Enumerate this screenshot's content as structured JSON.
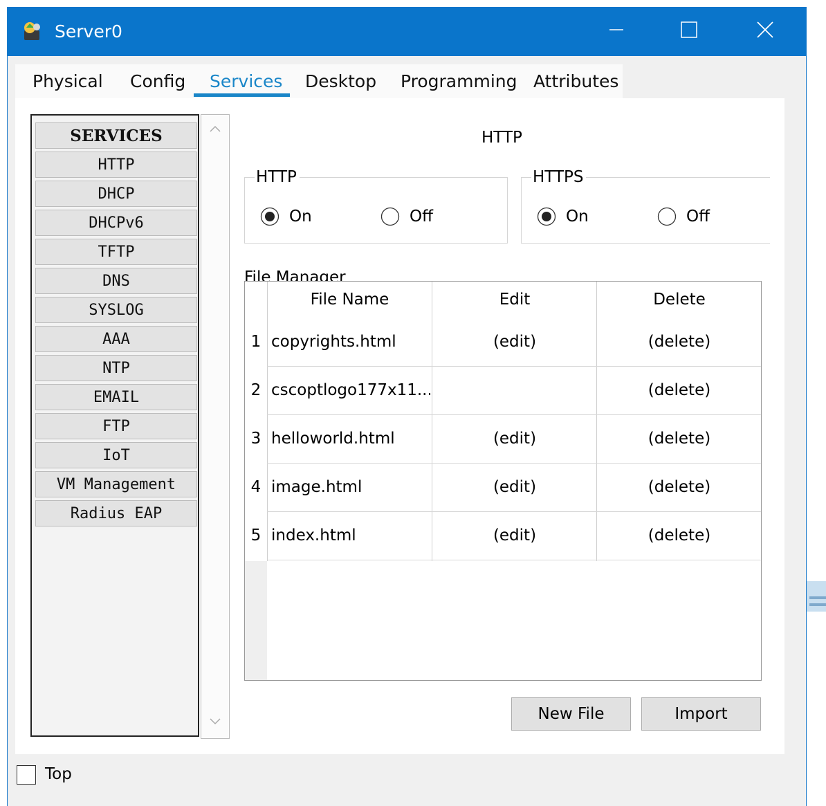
{
  "window": {
    "title": "Server0",
    "controls": {
      "minimize": "minimize-icon",
      "maximize": "maximize-icon",
      "close": "close-icon"
    }
  },
  "tabs": [
    {
      "label": "Physical",
      "active": false
    },
    {
      "label": "Config",
      "active": false
    },
    {
      "label": "Services",
      "active": true
    },
    {
      "label": "Desktop",
      "active": false
    },
    {
      "label": "Programming",
      "active": false
    },
    {
      "label": "Attributes",
      "active": false
    }
  ],
  "services": {
    "header": "SERVICES",
    "items": [
      "HTTP",
      "DHCP",
      "DHCPv6",
      "TFTP",
      "DNS",
      "SYSLOG",
      "AAA",
      "NTP",
      "EMAIL",
      "FTP",
      "IoT",
      "VM Management",
      "Radius EAP"
    ]
  },
  "main": {
    "title": "HTTP",
    "http": {
      "legend": "HTTP",
      "on_label": "On",
      "off_label": "Off",
      "selected": "On"
    },
    "https": {
      "legend": "HTTPS",
      "on_label": "On",
      "off_label": "Off",
      "selected": "On"
    },
    "file_manager": {
      "label": "File Manager",
      "columns": [
        "File Name",
        "Edit",
        "Delete"
      ],
      "rows": [
        {
          "num": "1",
          "name": "copyrights.html",
          "edit": "(edit)",
          "delete": "(delete)"
        },
        {
          "num": "2",
          "name": "cscoptlogo177x11...",
          "edit": "",
          "delete": "(delete)"
        },
        {
          "num": "3",
          "name": "helloworld.html",
          "edit": "(edit)",
          "delete": "(delete)"
        },
        {
          "num": "4",
          "name": "image.html",
          "edit": "(edit)",
          "delete": "(delete)"
        },
        {
          "num": "5",
          "name": "index.html",
          "edit": "(edit)",
          "delete": "(delete)"
        }
      ]
    },
    "buttons": {
      "new_file": "New File",
      "import": "Import"
    }
  },
  "footer": {
    "top_label": "Top",
    "top_checked": false
  },
  "colors": {
    "titlebar": "#0a75cb",
    "active_tab": "#1a86c8"
  }
}
